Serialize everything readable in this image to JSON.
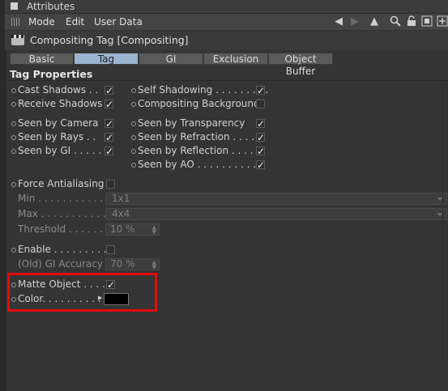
{
  "window_title": "Attributes",
  "menu": [
    "Mode",
    "Edit",
    "User Data"
  ],
  "toolbar_icons": [
    "arrow-left-icon",
    "arrow-right-icon",
    "arrow-up-icon",
    "search-icon",
    "lock-icon",
    "settings-icon",
    "new-panel-icon"
  ],
  "header_title": "Compositing Tag [Compositing]",
  "tabs": [
    {
      "label": "Basic",
      "active": false
    },
    {
      "label": "Tag",
      "active": true
    },
    {
      "label": "GI",
      "active": false
    },
    {
      "label": "Exclusion",
      "active": false
    },
    {
      "label": "Object Buffer",
      "active": false
    }
  ],
  "section_title": "Tag Properties",
  "left_params": [
    {
      "label": "Cast Shadows . .",
      "checked": true
    },
    {
      "label": "Receive Shadows",
      "checked": true
    },
    {
      "label": "Seen by Camera",
      "checked": true
    },
    {
      "label": "Seen by Rays . .",
      "checked": true
    },
    {
      "label": "Seen by GI . . . . .",
      "checked": true
    }
  ],
  "right_params": [
    {
      "label": "Self Shadowing . . . . . . . . .",
      "checked": true
    },
    {
      "label": "Compositing Background",
      "checked": false
    },
    {
      "label": "Seen by Transparency",
      "checked": true
    },
    {
      "label": "Seen by Refraction . . . . .",
      "checked": true
    },
    {
      "label": "Seen by Reflection . . . . .",
      "checked": true
    },
    {
      "label": "Seen by AO . . . . . . . . . . .",
      "checked": true
    }
  ],
  "force_aa": {
    "label": "Force Antialiasing",
    "checked": false
  },
  "min": {
    "label": "Min . . . . . . . . . . . . .",
    "value": "1x1"
  },
  "max": {
    "label": "Max . . . . . . . . . . . . .",
    "value": "4x4"
  },
  "threshold": {
    "label": "Threshold . . . . . .",
    "value": "10 %"
  },
  "enable": {
    "label": "Enable . . . . . . . . . .",
    "checked": false
  },
  "gi_accuracy": {
    "label": "(Old) GI Accuracy",
    "value": "70 %"
  },
  "matte_object": {
    "label": "Matte Object . . . . .",
    "checked": true
  },
  "color": {
    "label": "Color. . . . . . . . . . .",
    "value_hex": "#000000"
  },
  "highlight_color": "#e20b0b"
}
